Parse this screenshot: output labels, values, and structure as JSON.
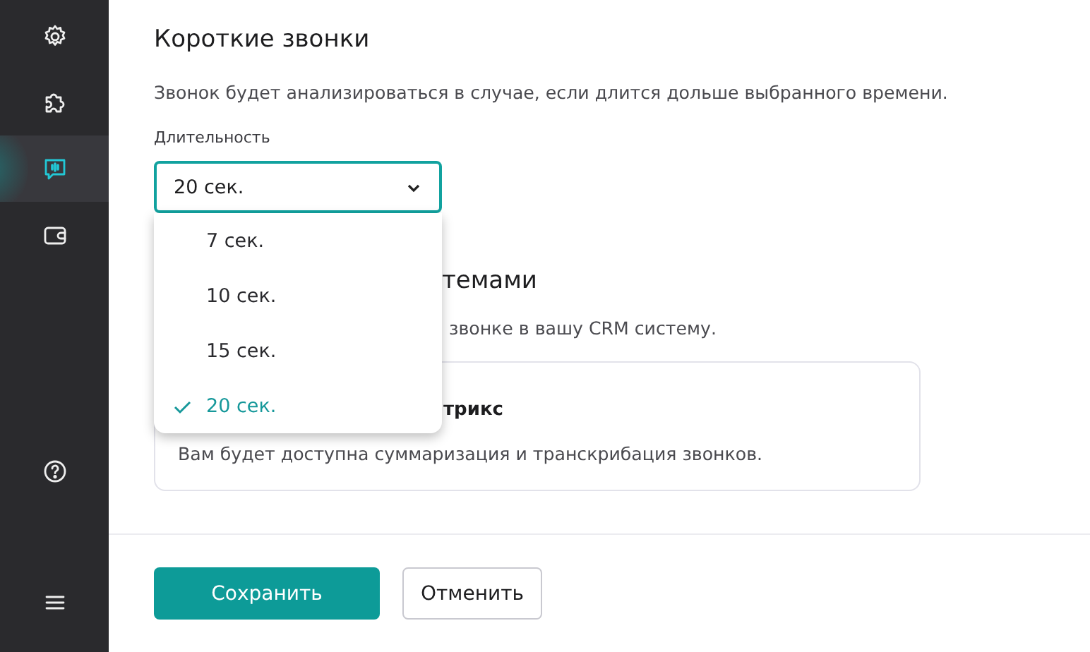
{
  "sidebar": {
    "items": [
      {
        "kind": "gear",
        "selected": false
      },
      {
        "kind": "puzzle",
        "selected": false
      },
      {
        "kind": "chat",
        "selected": true
      },
      {
        "kind": "wallet",
        "selected": false
      }
    ],
    "bottom_items": [
      {
        "kind": "help",
        "selected": false
      },
      {
        "kind": "menu",
        "selected": false
      }
    ]
  },
  "short_calls": {
    "title": "Короткие звонки",
    "description": "Звонок будет анализироваться в случае, если длится дольше выбранного времени.",
    "field_label": "Длительность",
    "select": {
      "value": "20 сек.",
      "options": [
        {
          "label": "7 сек.",
          "selected": false
        },
        {
          "label": "10 сек.",
          "selected": false
        },
        {
          "label": "15 сек.",
          "selected": false
        },
        {
          "label": "20 сек.",
          "selected": true
        }
      ]
    }
  },
  "integration": {
    "title": "темами",
    "description": "звонке в вашу CRM систему.",
    "card": {
      "title": "трикс",
      "description": "Вам будет доступна суммаризация и транскрибация звонков."
    }
  },
  "buttons": [
    {
      "label": "Сохранить",
      "kind": "primary"
    },
    {
      "label": "Отменить",
      "kind": "secondary"
    }
  ]
}
